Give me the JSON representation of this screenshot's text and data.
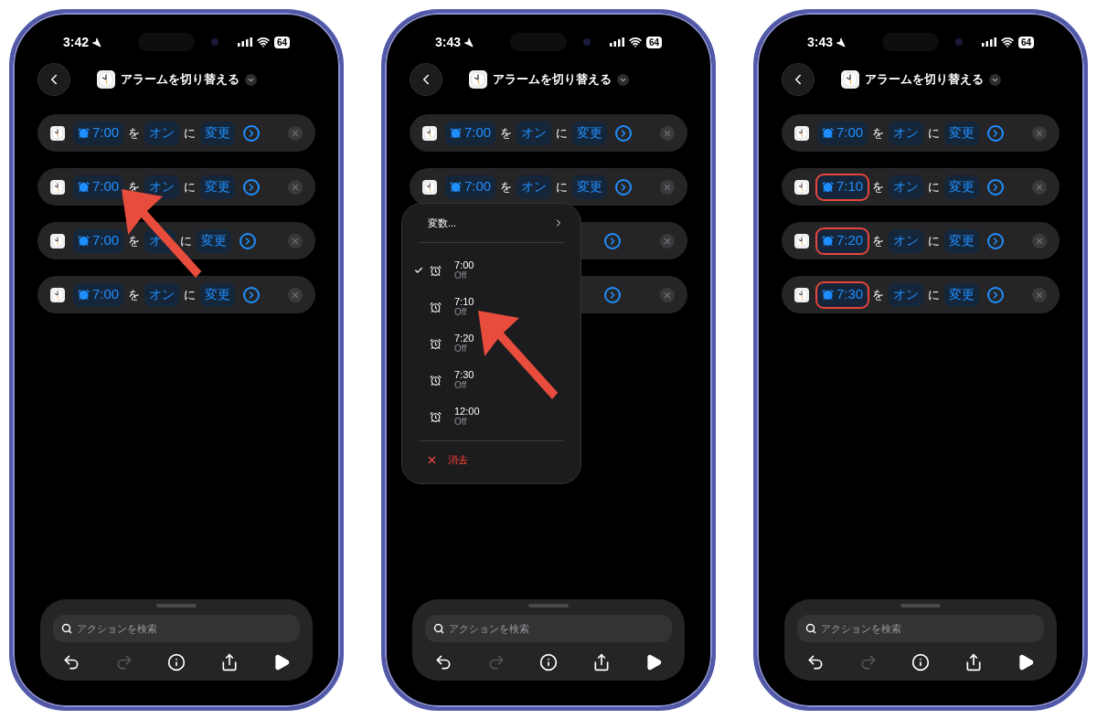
{
  "phones": [
    {
      "status_bar": {
        "time": "3:42",
        "battery": "64"
      },
      "title": "アラームを切り替える",
      "rows": [
        {
          "covered": false,
          "time": "7:00",
          "particle_1": "を",
          "state": "オン",
          "particle_2": "に",
          "action": "変更",
          "highlighted": false,
          "pointer": false
        },
        {
          "covered": false,
          "time": "7:00",
          "particle_1": "を",
          "state": "オン",
          "particle_2": "に",
          "action": "変更",
          "highlighted": false,
          "pointer": true
        },
        {
          "covered": false,
          "time": "7:00",
          "particle_1": "を",
          "state": "オ",
          "particle_2": "に",
          "action": "変更",
          "highlighted": false,
          "pointer": false
        },
        {
          "covered": false,
          "time": "7:00",
          "particle_1": "を",
          "state": "オン",
          "particle_2": "に",
          "action": "変更",
          "highlighted": false,
          "pointer": false
        }
      ],
      "search": {
        "placeholder": "アクションを検索"
      },
      "toolbar": [
        {
          "kind": "undo",
          "disabled": false
        },
        {
          "kind": "redo",
          "disabled": true
        },
        {
          "kind": "info",
          "disabled": false
        },
        {
          "kind": "share",
          "disabled": false
        },
        {
          "kind": "run",
          "disabled": false
        }
      ]
    },
    {
      "status_bar": {
        "time": "3:43",
        "battery": "64"
      },
      "title": "アラームを切り替える",
      "rows": [
        {
          "covered": false,
          "time": "7:00",
          "particle_1": "を",
          "state": "オン",
          "particle_2": "に",
          "action": "変更",
          "highlighted": false,
          "pointer": false
        },
        {
          "covered": false,
          "time": "7:00",
          "particle_1": "を",
          "state": "オン",
          "particle_2": "に",
          "action": "変更",
          "highlighted": false,
          "pointer": false
        },
        {
          "covered": true
        },
        {
          "covered": true
        }
      ],
      "menu": {
        "header": "変数...",
        "items": [
          {
            "time": "7:00",
            "status": "Off",
            "checked": true,
            "pointer": false
          },
          {
            "time": "7:10",
            "status": "Off",
            "checked": false,
            "pointer": true
          },
          {
            "time": "7:20",
            "status": "Off",
            "checked": false,
            "pointer": false
          },
          {
            "time": "7:30",
            "status": "Off",
            "checked": false,
            "pointer": false
          },
          {
            "time": "12:00",
            "status": "Off",
            "checked": false,
            "pointer": false
          }
        ],
        "clear": "消去"
      },
      "search": {
        "placeholder": "アクションを検索"
      },
      "toolbar": [
        {
          "kind": "undo",
          "disabled": false
        },
        {
          "kind": "redo",
          "disabled": true
        },
        {
          "kind": "info",
          "disabled": false
        },
        {
          "kind": "share",
          "disabled": false
        },
        {
          "kind": "run",
          "disabled": false
        }
      ]
    },
    {
      "status_bar": {
        "time": "3:43",
        "battery": "64"
      },
      "title": "アラームを切り替える",
      "rows": [
        {
          "covered": false,
          "time": "7:00",
          "particle_1": "を",
          "state": "オン",
          "particle_2": "に",
          "action": "変更",
          "highlighted": false,
          "pointer": false
        },
        {
          "covered": false,
          "time": "7:10",
          "particle_1": "を",
          "state": "オン",
          "particle_2": "に",
          "action": "変更",
          "highlighted": true,
          "pointer": false
        },
        {
          "covered": false,
          "time": "7:20",
          "particle_1": "を",
          "state": "オン",
          "particle_2": "に",
          "action": "変更",
          "highlighted": true,
          "pointer": false
        },
        {
          "covered": false,
          "time": "7:30",
          "particle_1": "を",
          "state": "オン",
          "particle_2": "に",
          "action": "変更",
          "highlighted": true,
          "pointer": false
        }
      ],
      "search": {
        "placeholder": "アクションを検索"
      },
      "toolbar": [
        {
          "kind": "undo",
          "disabled": false
        },
        {
          "kind": "redo",
          "disabled": true
        },
        {
          "kind": "info",
          "disabled": false
        },
        {
          "kind": "share",
          "disabled": false
        },
        {
          "kind": "run",
          "disabled": false
        }
      ]
    }
  ]
}
